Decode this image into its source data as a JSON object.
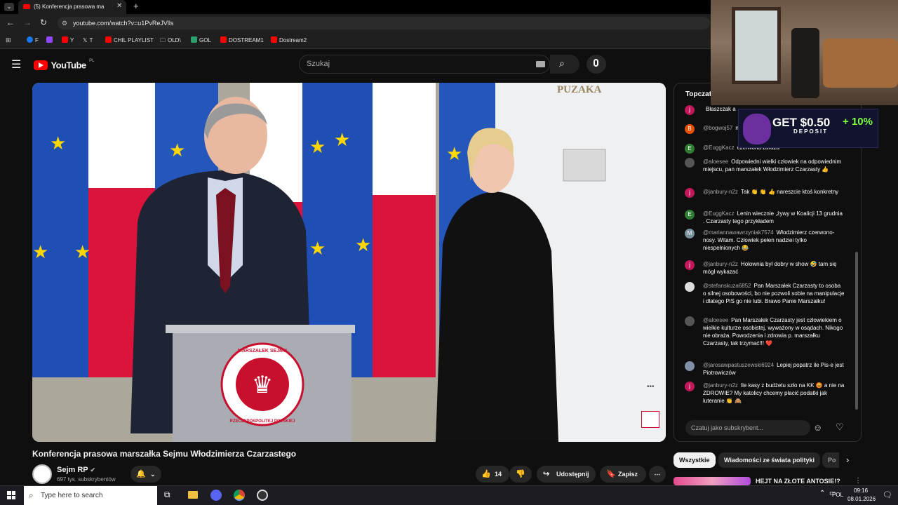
{
  "browser": {
    "tab_title": "(5) Konferencja prasowa ma",
    "url": "youtube.com/watch?v=u1PvReJVlls",
    "bookmarks": [
      "F",
      "Y",
      "T",
      "CHIL PLAYLIST",
      "OLD\\",
      "GOL",
      "DOSTREAM1",
      "Dostream2"
    ]
  },
  "youtube": {
    "logo_text": "YouTube",
    "region": "PL",
    "search_placeholder": "Szukaj",
    "video_title": "Konferencja prasowa marszałka Sejmu Włodzimierza Czarzastego",
    "channel_name": "Sejm RP",
    "subscribers": "697 tys. subskrybentów",
    "likes": "14",
    "share_label": "Udostępnij",
    "save_label": "Zapisz",
    "chips": [
      "Wszystkie",
      "Wiadomości ze świata polityki",
      "Po"
    ],
    "next_video_title": "HEJT NA ZŁOTE ANTOSIE!?",
    "video_overlay": {
      "podium_text_top": "MARSZAŁEK SEJMU",
      "podium_text_bottom": "RZECZYPOSPOLITEJ POLSKIEJ",
      "wall_sign": "PUZAKA"
    }
  },
  "chat": {
    "header": "Topczat",
    "input_placeholder": "Czatuj jako subskrybent...",
    "messages": [
      {
        "author": "",
        "text": "Błaszczak a",
        "initial": "j",
        "color": "#c2185b"
      },
      {
        "author": "@bogwoj57",
        "text": "nie pamięta?",
        "initial": "B",
        "color": "#e65100"
      },
      {
        "author": "@EuggKacz",
        "text": "czerwona zaraza",
        "initial": "E",
        "color": "#2e7d32"
      },
      {
        "author": "@aloesee",
        "text": "Odpowiedni wielki człowiek na odpowiednim miejscu, pan marszałek Włodzimierz Czarzasty 👍",
        "initial": "",
        "color": "#555"
      },
      {
        "author": "@janbury-n2z",
        "text": "Tak 👏 👏 👍 nareszcie ktoś konkretny",
        "initial": "j",
        "color": "#c2185b"
      },
      {
        "author": "@EuggKacz",
        "text": "Lenin wiecznie ,żywy w Koalicji 13 grudnia . Czarzasty tego przykładem",
        "initial": "E",
        "color": "#2e7d32"
      },
      {
        "author": "@mariannawawrzyniak7574",
        "text": "Włodzimierz czerwono- nosy. Witam. Człowiek pełen nadziei tylko niespełnionych 😂",
        "initial": "M",
        "color": "#78909c"
      },
      {
        "author": "@janbury-n2z",
        "text": "Holownia był dobry w show 🤣 tam się mógł wykazać",
        "initial": "j",
        "color": "#c2185b"
      },
      {
        "author": "@stefanskuza6852",
        "text": "Pan Marszałek Czarzasty to osoba o silnej osobowości, bo nie pozwoli sobie na manipulacje i dlatego PiS go nie lubi. Brawo Panie Marszałku!",
        "initial": "",
        "color": "#ddd"
      },
      {
        "author": "@aloesee",
        "text": "Pan Marszałek Czarzasty jest człowiekiem o wielkie kulturze osobistej, wyważony w osądach. Nikogo nie obraża. Powodzenia i zdrowia p. marszałku Czarzasty, tak trzymać!!! ❤️",
        "initial": "",
        "color": "#555"
      },
      {
        "author": "@jarosawpastuszewski6924",
        "text": "Lepiej popatrz ile Pis-e jest Piotrowiczów",
        "initial": "",
        "color": "#7e8fa6"
      },
      {
        "author": "@janbury-n2z",
        "text": "Ile kasy z budżetu szło na KK 😡 a nie na ZDROWIE? My katolicy chcemy płacić podatki jak luteranie 👏 🙈",
        "initial": "j",
        "color": "#c2185b"
      }
    ]
  },
  "ad": {
    "line1": "GET $0.50",
    "line2": "DEPOSIT",
    "bonus": "+ 10%"
  },
  "taskbar": {
    "search_placeholder": "Type here to search",
    "lang": "POL",
    "time": "09:16",
    "date": "08.01.2026"
  }
}
